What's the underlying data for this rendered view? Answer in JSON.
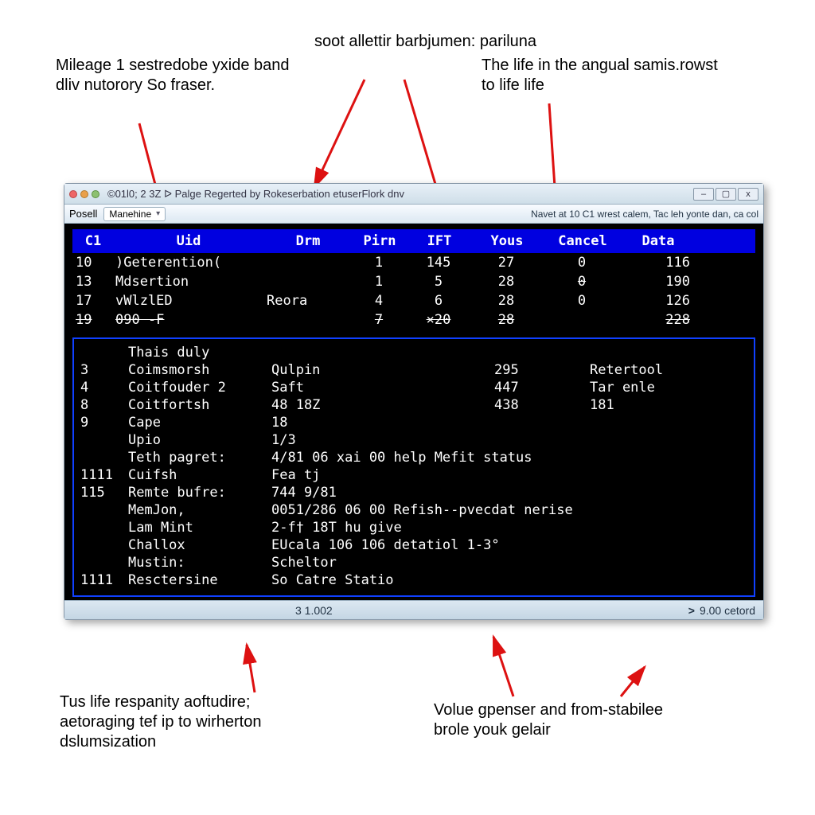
{
  "callouts": {
    "top_left": "Mileage 1 sestredobe yxide band dliv nutorory So fraser.",
    "top_center": "soot allettir barbjumen: pariluna",
    "top_right": "The life in the angual samis.rowst to life life",
    "bottom_left": "Tus life respanity aoftudire; aetoraging tef ip to wirherton dslumsization",
    "bottom_right": "Volue gpenser and from-stabilee brole youk gelair"
  },
  "window": {
    "title": "©01l0; 2 3Z ᐅ Palge Regerted by Rokeserbation etuserFlork dnv",
    "btn_min": "–",
    "btn_max": "▢",
    "btn_close": "x"
  },
  "toolbar": {
    "label": "Posell",
    "dropdown_value": "Manehine",
    "right_text": "Navet at 10 C1 wrest calem,  Tac leh yonte dan, ca col"
  },
  "columns": [
    "C1",
    "Uid",
    "Drm",
    "Pirn",
    "IFT",
    "Yous",
    "Cancel",
    "Data"
  ],
  "rows": [
    {
      "c0": "10",
      "c1": ")Geterention(",
      "c2": "",
      "c3": "1",
      "c4": "145",
      "c5": "27",
      "c6": "0",
      "c7": "116"
    },
    {
      "c0": "13",
      "c1": "Mdsertion",
      "c2": "",
      "c3": "1",
      "c4": "5",
      "c5": "28",
      "c6": "0",
      "c7": "190",
      "strike_c6": true
    },
    {
      "c0": "17",
      "c1": "       vWlzlED",
      "c2": "Reora",
      "c3": "4",
      "c4": "6",
      "c5": "28",
      "c6": "0",
      "c7": "126"
    },
    {
      "c0": "19",
      "c1": "       090 -F",
      "c2": "",
      "c3": "7",
      "c4": "×20",
      "c5": "28",
      "c6": "",
      "c7": "228",
      "strike_row": true
    }
  ],
  "panel": {
    "title": "Thais duly",
    "rows": [
      {
        "n": "3",
        "a": "Coimsmorsh",
        "b": "Qulpin",
        "c": "295",
        "d": "Retertool"
      },
      {
        "n": "4",
        "a": "Coitfouder 2",
        "b": "Saft",
        "c": "447",
        "d": "Tar enle"
      },
      {
        "n": "8",
        "a": "Coitfortsh",
        "b": "48 18Z",
        "c": "438",
        "d": "181"
      },
      {
        "n": "9",
        "a": "Cape",
        "b": "18",
        "c": "",
        "d": ""
      },
      {
        "n": "",
        "a": "Upio",
        "b": "1/3",
        "c": "",
        "d": ""
      },
      {
        "n": "",
        "a": "Teth pagret:",
        "b": "4/81 06 xai 00 help Mefit status",
        "c": "",
        "d": ""
      },
      {
        "n": "1111",
        "a": "Cuifsh",
        "b": " Fea tj",
        "c": "",
        "d": ""
      },
      {
        "n": "115",
        "a": "Remte bufre:",
        "b": "744 9/81",
        "c": "",
        "d": ""
      },
      {
        "n": "",
        "a": "MemJon,",
        "b": "0051/286 06 00 Refish--pvecdat nerise",
        "c": "",
        "d": ""
      },
      {
        "n": "",
        "a": "Lam Mint",
        "b": "2-f† 18T hu give",
        "c": "",
        "d": ""
      },
      {
        "n": "",
        "a": "Challox",
        "b": "EUcala 106 106 detatiol   1-3°",
        "c": "",
        "d": ""
      },
      {
        "n": "",
        "a": "Mustin:",
        "b": "Scheltor",
        "c": "",
        "d": ""
      },
      {
        "n": "1111",
        "a": "Resctersine",
        "b": "So Catre Statio",
        "c": "",
        "d": ""
      }
    ]
  },
  "statusbar": {
    "center": "3 1.002",
    "right_prefix": ">",
    "right_value": "9.00 cetord"
  }
}
